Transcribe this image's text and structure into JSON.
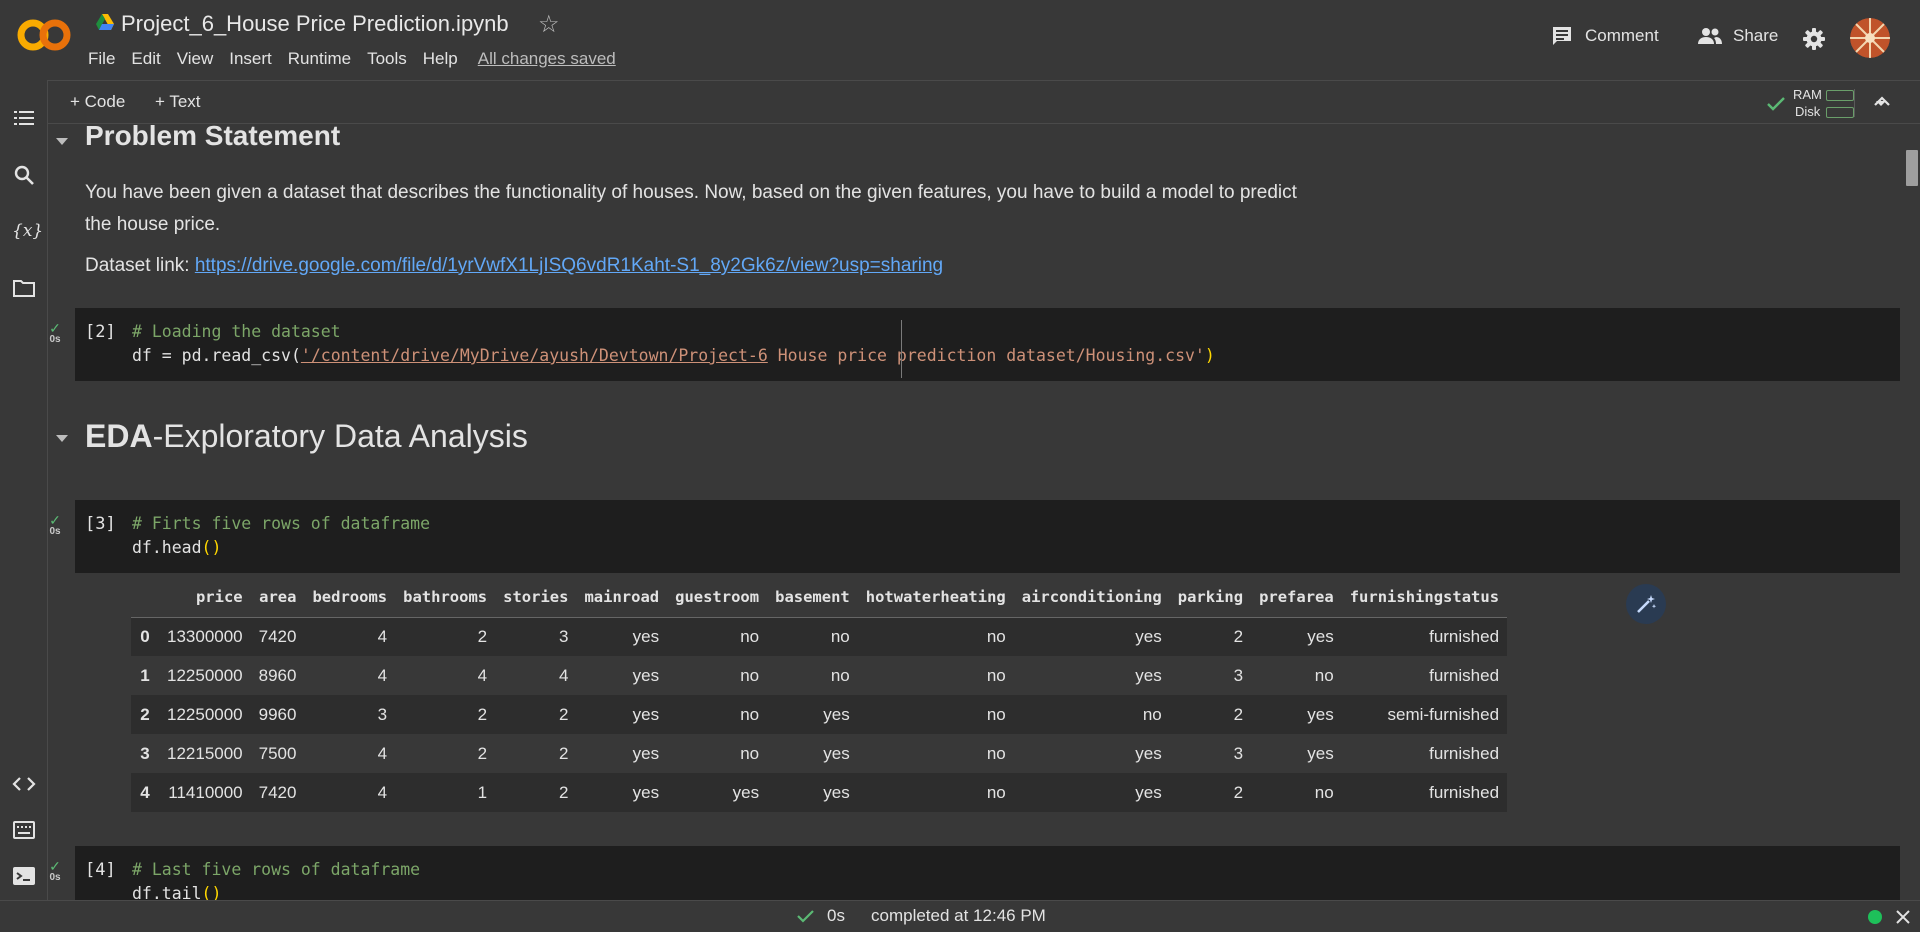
{
  "header": {
    "title": "Project_6_House Price Prediction.ipynb",
    "menu": [
      "File",
      "Edit",
      "View",
      "Insert",
      "Runtime",
      "Tools",
      "Help"
    ],
    "save_status": "All changes saved",
    "comment_label": "Comment",
    "share_label": "Share"
  },
  "toolbar": {
    "add_code": "+ Code",
    "add_text": "+ Text",
    "ram_label": "RAM",
    "disk_label": "Disk"
  },
  "sections": {
    "problem": {
      "title": "Problem Statement",
      "para1_line1": "You have been given a dataset that describes the functionality of houses. Now, based on the given features, you have to build a model to predict",
      "para1_line2": "the house price.",
      "dataset_label": "Dataset link: ",
      "dataset_url": "https://drive.google.com/file/d/1yrVwfX1LjISQ6vdR1Kaht-S1_8y2Gk6z/view?usp=sharing"
    },
    "eda": {
      "title_bold": "EDA",
      "title_rest": "-Exploratory Data Analysis"
    }
  },
  "cells": {
    "c2": {
      "count": "[2]",
      "time": "0s",
      "comment": "# Loading the dataset",
      "code_prefix": "df = pd.read_csv(",
      "code_path_underlined": "'/content/drive/MyDrive/ayush/Devtown/Project-6",
      "code_path_rest": " House price prediction dataset/Housing.csv'",
      "code_suffix": ")"
    },
    "c3": {
      "count": "[3]",
      "time": "0s",
      "comment": "# Firts five rows of dataframe",
      "code_prefix": "df.head",
      "code_paren": "()"
    },
    "c4": {
      "count": "[4]",
      "time": "0s",
      "comment": "# Last five rows of dataframe",
      "code_prefix": "df.tail",
      "code_paren": "()"
    }
  },
  "table": {
    "columns": [
      "",
      "price",
      "area",
      "bedrooms",
      "bathrooms",
      "stories",
      "mainroad",
      "guestroom",
      "basement",
      "hotwaterheating",
      "airconditioning",
      "parking",
      "prefarea",
      "furnishingstatus"
    ],
    "rows": [
      [
        "0",
        "13300000",
        "7420",
        "4",
        "2",
        "3",
        "yes",
        "no",
        "no",
        "no",
        "yes",
        "2",
        "yes",
        "furnished"
      ],
      [
        "1",
        "12250000",
        "8960",
        "4",
        "4",
        "4",
        "yes",
        "no",
        "no",
        "no",
        "yes",
        "3",
        "no",
        "furnished"
      ],
      [
        "2",
        "12250000",
        "9960",
        "3",
        "2",
        "2",
        "yes",
        "no",
        "yes",
        "no",
        "no",
        "2",
        "yes",
        "semi-furnished"
      ],
      [
        "3",
        "12215000",
        "7500",
        "4",
        "2",
        "2",
        "yes",
        "no",
        "yes",
        "no",
        "yes",
        "3",
        "yes",
        "furnished"
      ],
      [
        "4",
        "11410000",
        "7420",
        "4",
        "1",
        "2",
        "yes",
        "yes",
        "yes",
        "no",
        "yes",
        "2",
        "no",
        "furnished"
      ]
    ]
  },
  "status": {
    "time": "0s",
    "completed": "completed at 12:46 PM"
  },
  "colors": {
    "background": "#383838",
    "cell_bg": "#1e1e1e",
    "link": "#62a8f7",
    "check": "#5bb974",
    "comment": "#7ca668",
    "string": "#ce9178",
    "paren": "#ffd700"
  }
}
